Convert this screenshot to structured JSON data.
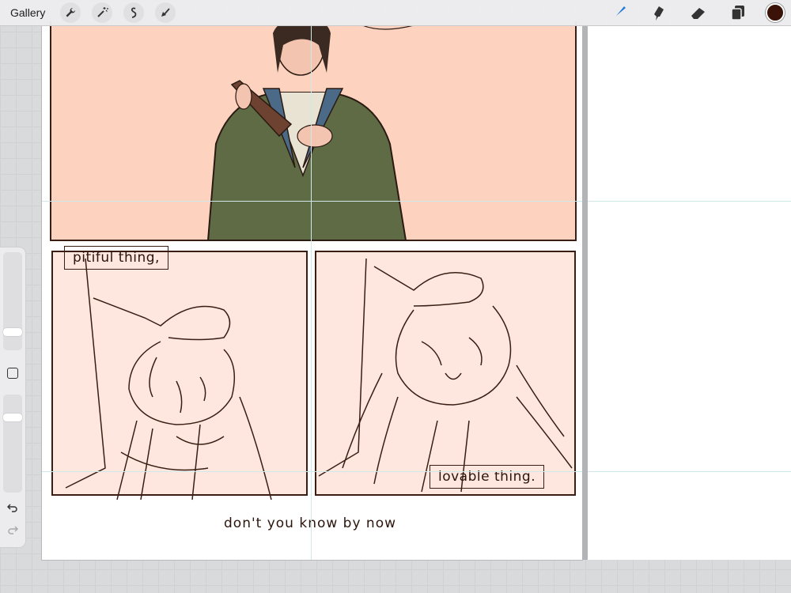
{
  "toolbar": {
    "gallery_label": "Gallery",
    "left_tools": [
      "wrench-icon",
      "magic-wand-icon",
      "selection-icon",
      "transform-icon"
    ],
    "right_tools": [
      "brush-icon",
      "smudge-icon",
      "eraser-icon",
      "layers-icon"
    ],
    "active_color": "#3b1208",
    "brush_active_color": "#1e7bd9"
  },
  "canvas": {
    "caption_left": "pitiful thing,",
    "caption_right": "lovable thing.",
    "bottom_text": "don't you know by now",
    "panel_top_color": "#fdd2bf",
    "panel_bottom_color": "#fde7de",
    "line_color": "#3a1e14"
  },
  "sidebar": {
    "undo_icon": "undo-icon",
    "redo_icon": "redo-icon"
  }
}
